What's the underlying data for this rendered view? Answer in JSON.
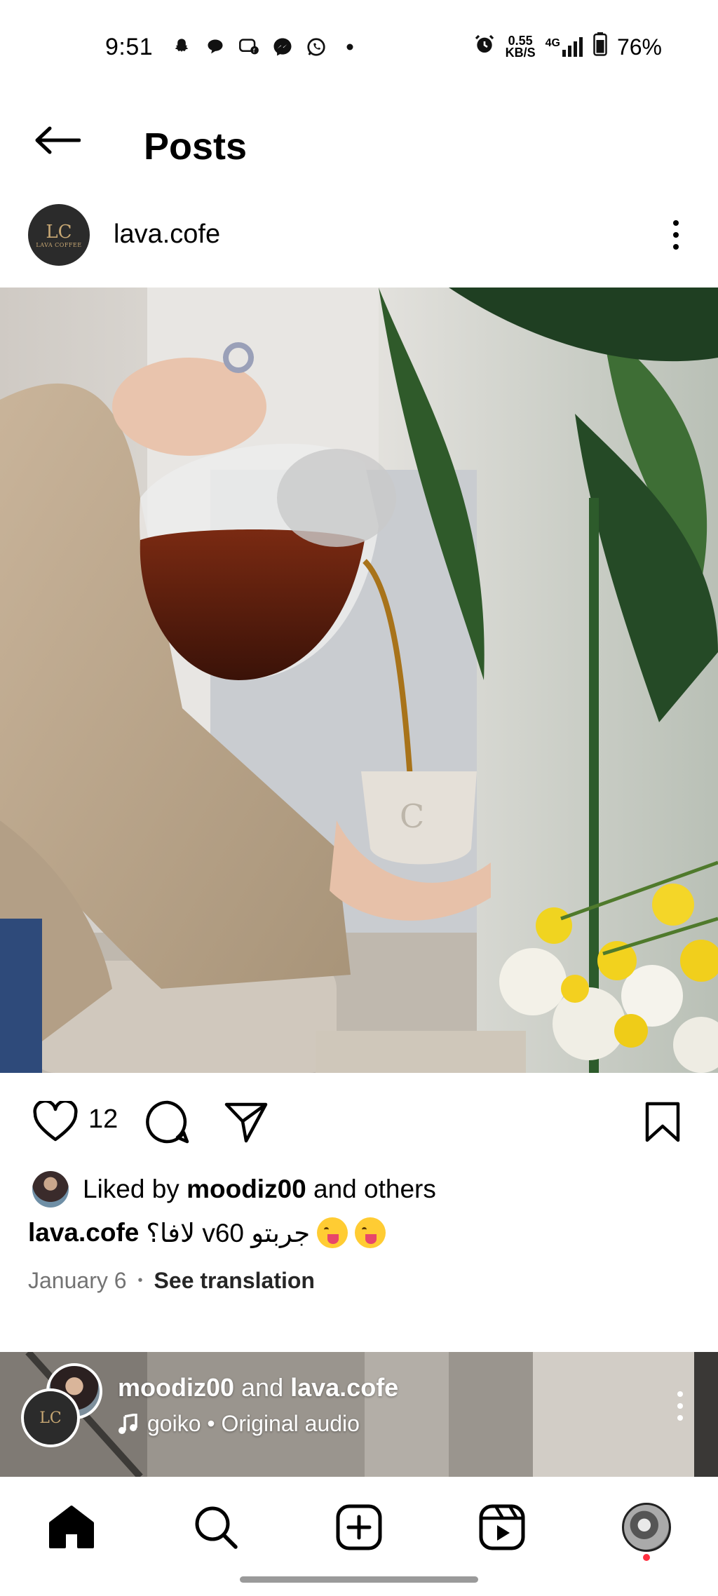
{
  "status_bar": {
    "time": "9:51",
    "net_speed_value": "0.55",
    "net_speed_unit": "KB/S",
    "network": "4G",
    "battery": "76%",
    "icons": [
      "snapchat-icon",
      "chat-icon",
      "facebook-chat-icon",
      "messenger-icon",
      "whatsapp-icon",
      "dot-icon",
      "alarm-icon",
      "signal-icon",
      "battery-icon"
    ]
  },
  "header": {
    "title": "Posts"
  },
  "post": {
    "username": "lava.cofe",
    "avatar_monogram": "LC",
    "avatar_brand": "LAVA COFFEE",
    "like_count": "12",
    "likes_prefix": "Liked by ",
    "likes_user": "moodiz00",
    "likes_suffix": " and others",
    "caption_user": "lava.cofe",
    "caption_text": "جربتو v60 لافا؟",
    "date": "January 6",
    "dot": "•",
    "see_translation": "See translation"
  },
  "next_post": {
    "user1": "moodiz00",
    "joiner": " and ",
    "user2": "lava.cofe",
    "audio": "goiko • Original audio"
  },
  "colors": {
    "text": "#000000",
    "secondary": "#737373",
    "notification_dot": "#ff3040"
  }
}
